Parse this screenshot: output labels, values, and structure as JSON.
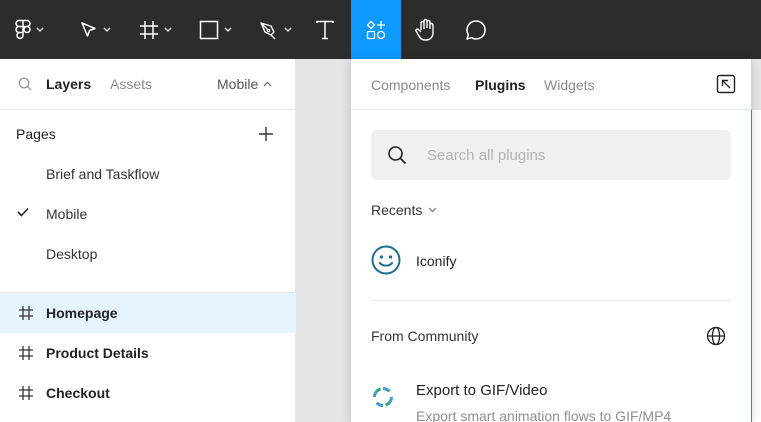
{
  "toolbar": {
    "tools": [
      {
        "icon": "figma-menu-icon",
        "has_caret": true
      },
      {
        "icon": "move-tool-icon",
        "has_caret": true
      },
      {
        "icon": "frame-tool-icon",
        "has_caret": true
      },
      {
        "icon": "rectangle-tool-icon",
        "has_caret": true
      },
      {
        "icon": "pen-tool-icon",
        "has_caret": true
      },
      {
        "icon": "text-tool-icon",
        "has_caret": false
      },
      {
        "icon": "resources-icon",
        "has_caret": false,
        "active": true
      },
      {
        "icon": "hand-tool-icon",
        "has_caret": false
      },
      {
        "icon": "comment-tool-icon",
        "has_caret": false
      }
    ],
    "colors": {
      "bg": "#2c2c2c",
      "active": "#0d99ff"
    }
  },
  "left_panel": {
    "tabs": {
      "layers": "Layers",
      "assets": "Assets"
    },
    "page_dropdown": "Mobile",
    "pages_title": "Pages",
    "pages": [
      {
        "label": "Brief and Taskflow",
        "current": false
      },
      {
        "label": "Mobile",
        "current": true
      },
      {
        "label": "Desktop",
        "current": false
      }
    ],
    "frames": [
      {
        "label": "Homepage",
        "selected": true
      },
      {
        "label": "Product Details",
        "selected": false
      },
      {
        "label": "Checkout",
        "selected": false
      }
    ]
  },
  "resources": {
    "tabs": [
      {
        "label": "Components",
        "active": false
      },
      {
        "label": "Plugins",
        "active": true
      },
      {
        "label": "Widgets",
        "active": false
      }
    ],
    "search_placeholder": "Search all plugins",
    "recents_label": "Recents",
    "recent_plugins": [
      {
        "name": "Iconify",
        "icon": "smiley-icon"
      }
    ],
    "community_label": "From Community",
    "community_plugins": [
      {
        "name": "Export to GIF/Video",
        "description": "Export smart animation flows to GIF/MP4",
        "icon": "gif-export-icon"
      }
    ]
  }
}
